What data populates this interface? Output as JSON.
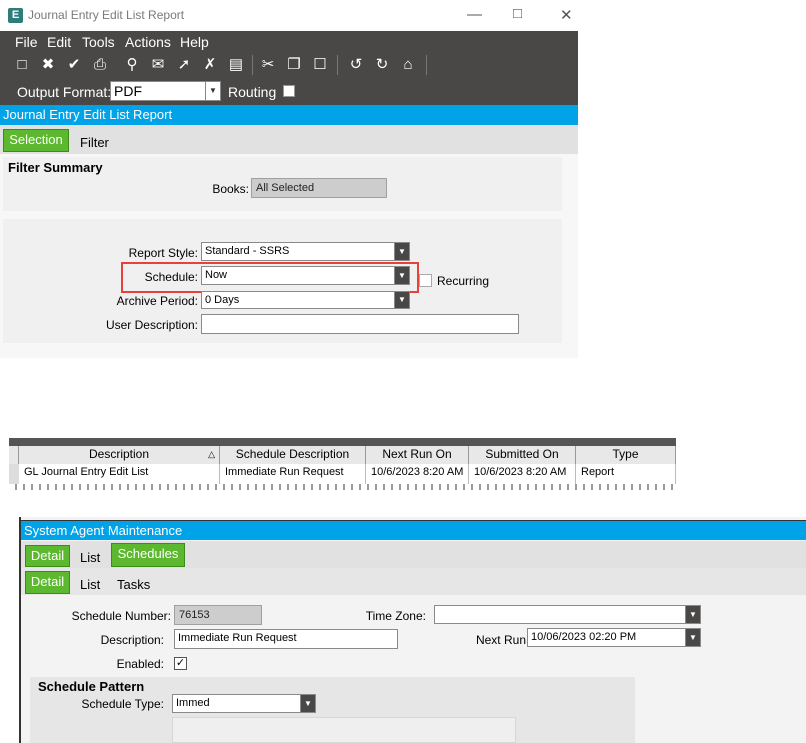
{
  "window": {
    "title": "Journal Entry Edit List Report",
    "logo": "E"
  },
  "menu": [
    "File",
    "Edit",
    "Tools",
    "Actions",
    "Help"
  ],
  "toolbar_icons": [
    "new-icon",
    "delete-icon",
    "clear-icon",
    "print-icon",
    "print-preview-icon",
    "send-icon",
    "attach-icon",
    "tools-icon",
    "save-icon",
    "cut-icon",
    "copy-icon",
    "paste-icon",
    "back-icon",
    "forward-icon",
    "home-icon"
  ],
  "output": {
    "label": "Output Format:",
    "value": "PDF",
    "routing_label": "Routing"
  },
  "report": {
    "header": "Journal Entry Edit List Report",
    "tabs": [
      "Selection",
      "Filter"
    ],
    "filter_summary_title": "Filter Summary",
    "books_label": "Books:",
    "books_value": "All Selected",
    "report_style_label": "Report Style:",
    "report_style_value": "Standard - SSRS",
    "schedule_label": "Schedule:",
    "schedule_value": "Now",
    "recurring_label": "Recurring",
    "archive_label": "Archive Period:",
    "archive_value": "0 Days",
    "user_desc_label": "User Description:",
    "user_desc_value": ""
  },
  "grid": {
    "columns": [
      "Description",
      "Schedule Description",
      "Next Run On",
      "Submitted On",
      "Type"
    ],
    "rows": [
      [
        "GL Journal Entry Edit List",
        "Immediate Run Request",
        "10/6/2023 8:20 AM",
        "10/6/2023 8:20 AM",
        "Report"
      ]
    ]
  },
  "agent": {
    "header": "System Agent Maintenance",
    "tabs": [
      "Detail",
      "List",
      "Schedules"
    ],
    "subtabs": [
      "Detail",
      "List",
      "Tasks"
    ],
    "schedule_number_label": "Schedule Number:",
    "schedule_number_value": "76153",
    "time_zone_label": "Time Zone:",
    "time_zone_value": "",
    "description_label": "Description:",
    "description_value": "Immediate Run Request",
    "next_run_label": "Next Run",
    "next_run_value": "10/06/2023 02:20 PM",
    "enabled_label": "Enabled:",
    "schedule_pattern_title": "Schedule Pattern",
    "schedule_type_label": "Schedule Type:",
    "schedule_type_value": "Immed"
  },
  "colors": {
    "accent_blue": "#00a2e8",
    "tab_green": "#5cb82e",
    "toolbar_dark": "#4a4847",
    "highlight_red": "#e8413c"
  }
}
